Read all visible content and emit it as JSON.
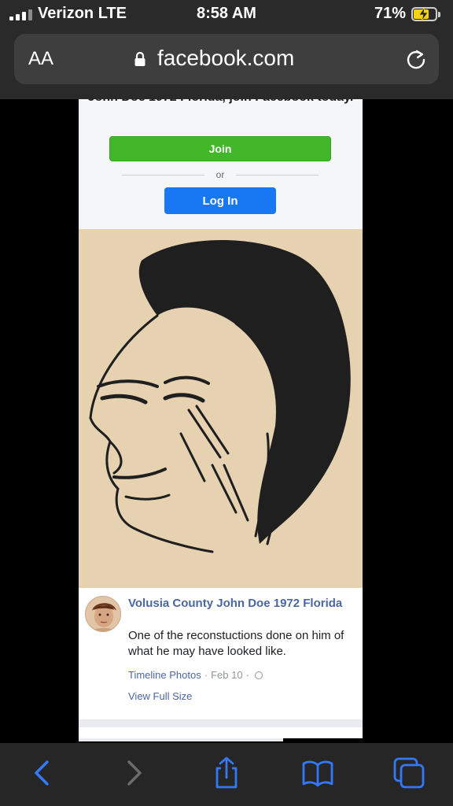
{
  "status_bar": {
    "carrier": "Verizon LTE",
    "time": "8:58 AM",
    "battery_percent": "71%",
    "battery_level": 0.71,
    "battery_color": "#f5d314",
    "icons": [
      "signal-bars-icon",
      "battery-charging-icon"
    ]
  },
  "address_bar": {
    "text_size_button": "AA",
    "domain": "facebook.com",
    "icons": [
      "lock-icon",
      "reload-icon"
    ]
  },
  "signup": {
    "prompt": "John Doe 1972 Florida, join Facebook today.",
    "join_label": "Join",
    "or_label": "or",
    "login_label": "Log In",
    "join_color": "#42b72a",
    "login_color": "#1877f2"
  },
  "post": {
    "page_name": "Volusia County John Doe 1972 Florida",
    "text": "One of the reconstuctions done on him of what he may have looked like.",
    "album": "Timeline Photos",
    "separator": "·",
    "date": "Feb 10",
    "date_separator": "·",
    "audience_icon": "globe-icon",
    "view_full_size": "View Full Size",
    "link_color": "#4b67a1",
    "photo_background": "#e6d1b1"
  },
  "toolbar": {
    "icons": [
      "back-icon",
      "forward-icon",
      "share-icon",
      "bookmarks-icon",
      "tabs-icon"
    ],
    "accent": "#3478f6"
  }
}
